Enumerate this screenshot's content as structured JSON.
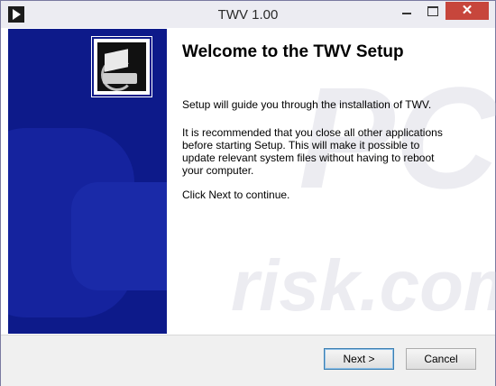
{
  "window": {
    "title": "TWV 1.00",
    "close_glyph": "✕"
  },
  "content": {
    "heading": "Welcome to the TWV Setup",
    "paragraphs": [
      "Setup will guide you through the installation of TWV.",
      "It is recommended that you close all other applications before starting Setup. This will make it possible to update relevant system files without having to reboot your computer.",
      "Click Next to continue."
    ]
  },
  "buttons": {
    "next_label": "Next >",
    "cancel_label": "Cancel"
  },
  "watermark": {
    "line1": "PC",
    "line2": "risk.com"
  },
  "colors": {
    "banner": "#0d1a8a",
    "close_button": "#c7463c"
  },
  "icons": {
    "app": "play-triangle-icon",
    "logo": "installer-computer-icon"
  }
}
